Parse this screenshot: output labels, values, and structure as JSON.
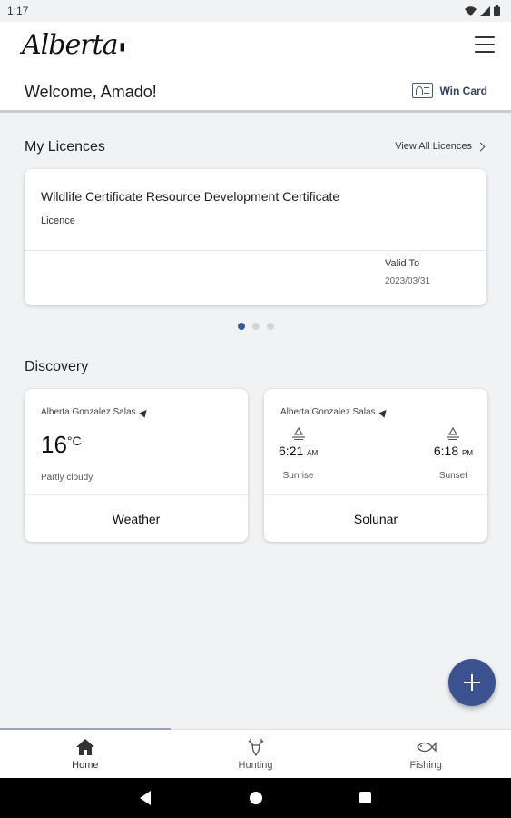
{
  "status_bar": {
    "time": "1:17"
  },
  "header": {
    "logo": "Alberta",
    "logo_mark": "▮",
    "welcome": "Welcome, Amado!",
    "win_card_label": "Win Card"
  },
  "licences": {
    "section_title": "My Licences",
    "view_all": "View All Licences",
    "card": {
      "title": "Wildlife Certificate Resource Development Certificate",
      "type": "Licence",
      "valid_label": "Valid To",
      "valid_date": "2023/03/31"
    },
    "pager": {
      "count": 3,
      "active_index": 0
    }
  },
  "discovery": {
    "section_title": "Discovery",
    "weather": {
      "location": "Alberta Gonzalez Salas",
      "temperature": "16",
      "unit": "°C",
      "condition": "Partly cloudy",
      "footer": "Weather"
    },
    "solunar": {
      "location": "Alberta Gonzalez Salas",
      "sunrise_time": "6:21",
      "sunrise_ampm": "AM",
      "sunrise_label": "Sunrise",
      "sunset_time": "6:18",
      "sunset_ampm": "PM",
      "sunset_label": "Sunset",
      "footer": "Solunar"
    }
  },
  "bottom_nav": {
    "items": [
      {
        "label": "Home",
        "icon": "home-icon",
        "active": true
      },
      {
        "label": "Hunting",
        "icon": "deer-icon",
        "active": false
      },
      {
        "label": "Fishing",
        "icon": "fish-icon",
        "active": false
      }
    ]
  },
  "colors": {
    "accent": "#3b5190",
    "background": "#f1f2f4",
    "card": "#ffffff"
  }
}
